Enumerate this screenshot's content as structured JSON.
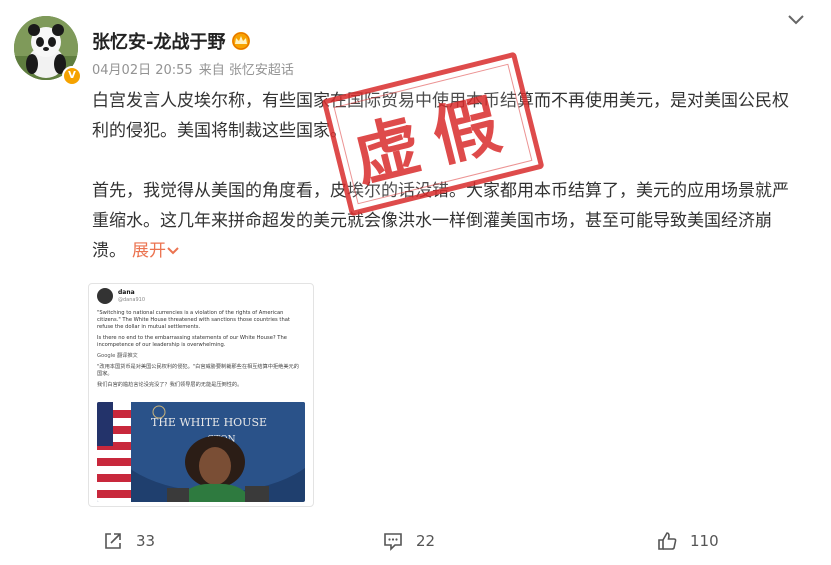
{
  "post": {
    "author": "张忆安-龙战于野",
    "date": "04月02日 20:55",
    "source": "来自 张忆安超话",
    "paragraph1": "白宫发言人皮埃尔称，有些国家在国际贸易中使用本币结算而不再使用美元，是对美国公民权利的侵犯。美国将制裁这些国家。",
    "paragraph2": "首先，我觉得从美国的角度看，皮埃尔的话没错。大家都用本币结算了，美元的应用场景就严重缩水。这几年来拼命超发的美元就会像洪水一样倒灌美国市场，甚至可能导致美国经济崩溃。",
    "expand_label": "展开"
  },
  "stamp_text": "虚假",
  "embed": {
    "name": "dana",
    "handle": "@dana910",
    "text1": "\"Switching to national currencies is a violation of the rights of American citizens.\" The White House threatened with sanctions those countries that refuse the dollar in mutual settlements.",
    "text2": "Is there no end to the embarrassing statements of our White House? The incompetence of our leadership is overwhelming.",
    "google_label": "Google 翻译推文",
    "cn1": "\"改用本国货币是对美国公民权利的侵犯。\"白宫威胁要制裁那些在相互结算中拒绝美元的国家。",
    "cn2": "我们白宫的尴尬言论没完没了？我们领导层的无能是压倒性的。",
    "photo_caption": "THE WHITE HOUSE",
    "photo_caption2": "GTON"
  },
  "actions": {
    "repost_count": "33",
    "comment_count": "22",
    "like_count": "110"
  },
  "colors": {
    "accent": "#eb7350",
    "stamp": "#d92c2c",
    "meta": "#939393",
    "badge": "#f5a200"
  }
}
